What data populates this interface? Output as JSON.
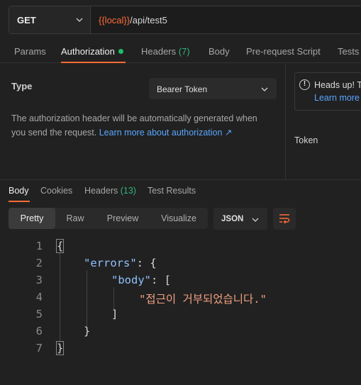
{
  "request": {
    "method": "GET",
    "url_var": "{{local}}",
    "url_path": "/api/test5"
  },
  "request_tabs": [
    {
      "label": "Params"
    },
    {
      "label": "Authorization"
    },
    {
      "label": "Headers",
      "count": "(7)"
    },
    {
      "label": "Body"
    },
    {
      "label": "Pre-request Script"
    },
    {
      "label": "Tests"
    }
  ],
  "auth": {
    "type_label": "Type",
    "type_value": "Bearer Token",
    "description": "The authorization header will be automatically generated when you send the request.",
    "learn_more": "Learn more about authorization ↗",
    "headsup_title": "Heads up! T",
    "headsup_link": "Learn more",
    "token_label": "Token"
  },
  "response_tabs": [
    {
      "label": "Body"
    },
    {
      "label": "Cookies"
    },
    {
      "label": "Headers",
      "count": "(13)"
    },
    {
      "label": "Test Results"
    }
  ],
  "view_modes": [
    "Pretty",
    "Raw",
    "Preview",
    "Visualize"
  ],
  "format": "JSON",
  "code_lines": [
    {
      "num": "1",
      "text": "{"
    },
    {
      "num": "2",
      "key": "\"errors\"",
      "rest": ": {"
    },
    {
      "num": "3",
      "key": "\"body\"",
      "rest": ": ["
    },
    {
      "num": "4",
      "value": "\"접근이 거부되었습니다.\""
    },
    {
      "num": "5",
      "text": "]"
    },
    {
      "num": "6",
      "text": "}"
    },
    {
      "num": "7",
      "text": "}"
    }
  ],
  "colors": {
    "accent": "#ff6c37",
    "link": "#58a6ff",
    "count": "#2fb57a"
  }
}
